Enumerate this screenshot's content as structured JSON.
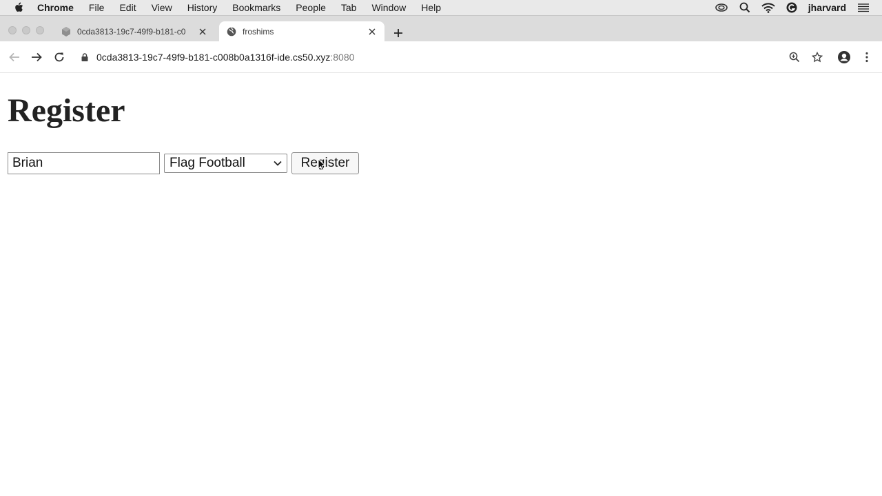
{
  "menubar": {
    "app_name": "Chrome",
    "items": [
      "File",
      "Edit",
      "View",
      "History",
      "Bookmarks",
      "People",
      "Tab",
      "Window",
      "Help"
    ],
    "user": "jharvard"
  },
  "tabs": [
    {
      "title": "0cda3813-19c7-49f9-b181-c0",
      "active": false
    },
    {
      "title": "froshims",
      "active": true
    }
  ],
  "address_bar": {
    "url": "0cda3813-19c7-49f9-b181-c008b0a1316f-ide.cs50.xyz",
    "port": ":8080"
  },
  "page": {
    "heading": "Register",
    "name_input": {
      "value": "Brian"
    },
    "sport_select": {
      "selected": "Flag Football"
    },
    "submit_label": "Register"
  }
}
